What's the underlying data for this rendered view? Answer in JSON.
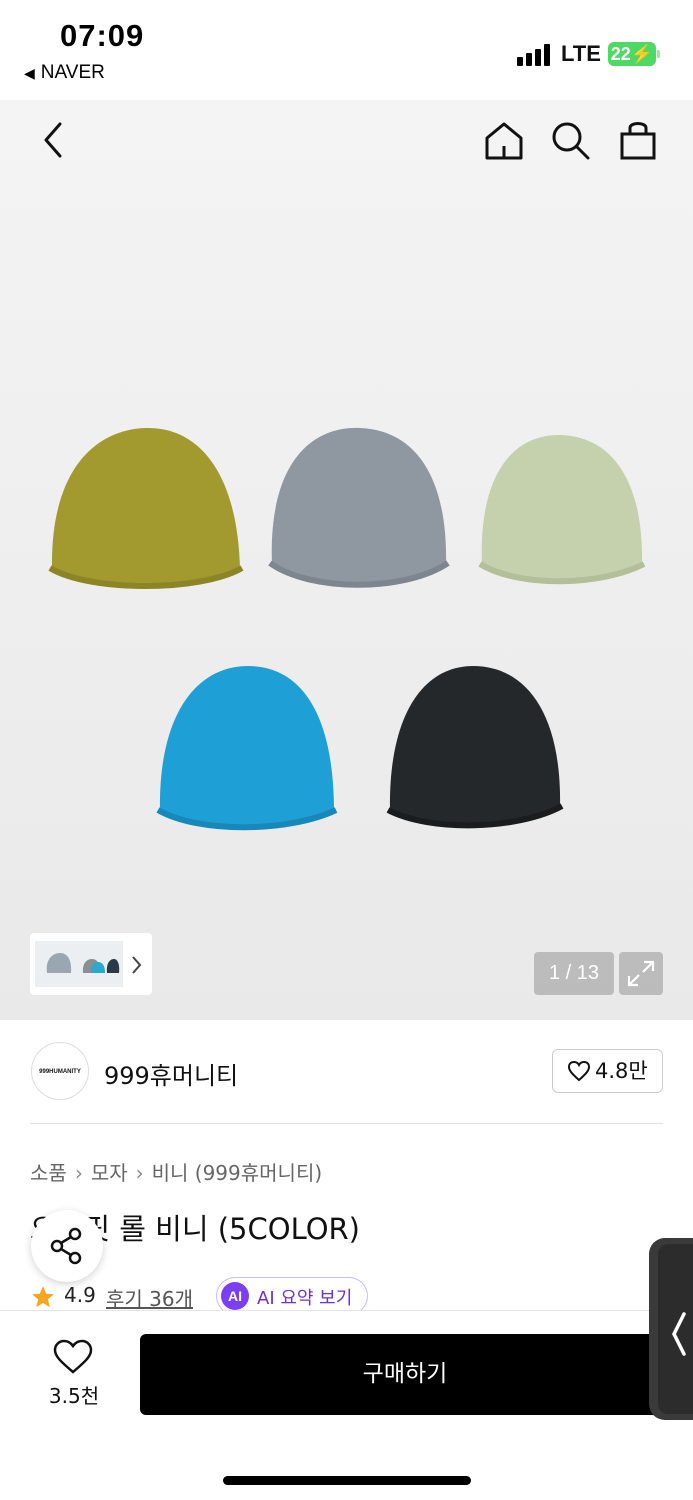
{
  "status_bar": {
    "time": "07:09",
    "back_app": "NAVER",
    "network": "LTE",
    "battery": "22"
  },
  "header_icons": [
    "back-icon",
    "home-icon",
    "search-icon",
    "shopping-bag-icon"
  ],
  "gallery": {
    "counter": "1 / 13",
    "hat_colors": [
      "#a29a2e",
      "#8f98a0",
      "#c5d1ac",
      "#1e9fd6",
      "#25282b"
    ]
  },
  "brand": {
    "logo_text": "999HUMANITY",
    "name": "999휴머니티",
    "likes": "4.8만"
  },
  "breadcrumb": [
    "소품",
    "모자",
    "비니 (999휴머니티)"
  ],
  "product": {
    "title": "오버핏 롤 비니 (5COLOR)",
    "rating": "4.9",
    "reviews": "후기 36개",
    "ai_badge": "AI",
    "ai_summary": "AI 요약 보기"
  },
  "bottom": {
    "wish_count": "3.5천",
    "buy_label": "구매하기"
  },
  "colors": {
    "accent_purple": "#7a3ff2",
    "star": "#f5a623",
    "battery_green": "#4cd964"
  }
}
